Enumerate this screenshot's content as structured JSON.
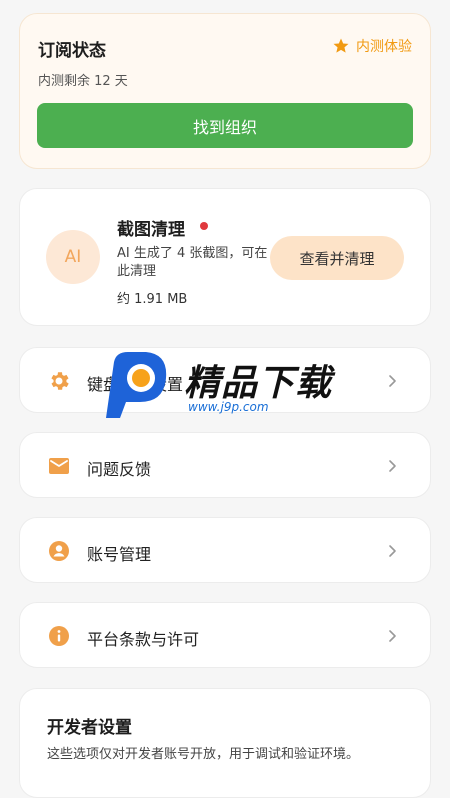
{
  "subscription": {
    "title": "订阅状态",
    "badge": "内测体验",
    "badge_icon": "star-icon",
    "remaining": "内测剩余 12 天",
    "button_label": "找到组织",
    "accent_color": "#f19a12",
    "button_color": "#4caf50"
  },
  "cleanup": {
    "avatar_text": "AI",
    "title": "截图清理",
    "description": "AI 生成了 4 张截图，可在此清理",
    "size": "约 1.91 MB",
    "button_label": "查看并清理",
    "dot_color": "#e0393e"
  },
  "settings_list": {
    "items": [
      {
        "label": "键盘快捷设置",
        "icon": "gear-icon"
      },
      {
        "label": "问题反馈",
        "icon": "mail-icon"
      },
      {
        "label": "账号管理",
        "icon": "account-icon"
      },
      {
        "label": "平台条款与许可",
        "icon": "info-icon"
      }
    ]
  },
  "developer": {
    "title": "开发者设置",
    "description": "这些选项仅对开发者账号开放，用于调试和验证环境。"
  },
  "watermark": {
    "name": "精品下载",
    "url": "www.j9p.com"
  }
}
